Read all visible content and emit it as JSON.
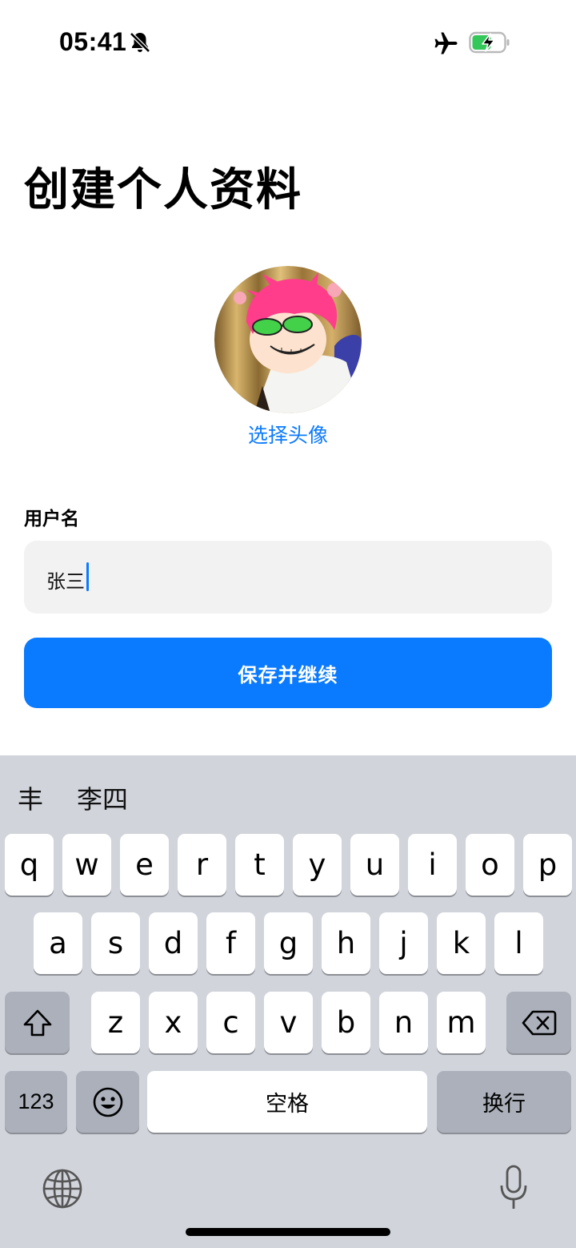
{
  "status_bar": {
    "time": "05:41",
    "icons": [
      "bell-off-icon",
      "airplane-icon",
      "battery-charging-icon"
    ],
    "battery_color": "#34c759"
  },
  "title": "创建个人资料",
  "avatar": {
    "choose_label": "选择头像"
  },
  "username": {
    "label": "用户名",
    "value": "张三"
  },
  "save_button": {
    "label": "保存并继续"
  },
  "keyboard": {
    "candidates": [
      "丰",
      "李四"
    ],
    "row1": [
      "q",
      "w",
      "e",
      "r",
      "t",
      "y",
      "u",
      "i",
      "o",
      "p"
    ],
    "row2": [
      "a",
      "s",
      "d",
      "f",
      "g",
      "h",
      "j",
      "k",
      "l"
    ],
    "row3": [
      "z",
      "x",
      "c",
      "v",
      "b",
      "n",
      "m"
    ],
    "numbers_label": "123",
    "space_label": "空格",
    "return_label": "换行"
  },
  "colors": {
    "accent": "#0a7aff",
    "input_bg": "#f2f2f3",
    "keyboard_bg": "#d1d4db",
    "key_dark": "#abb0ba"
  }
}
